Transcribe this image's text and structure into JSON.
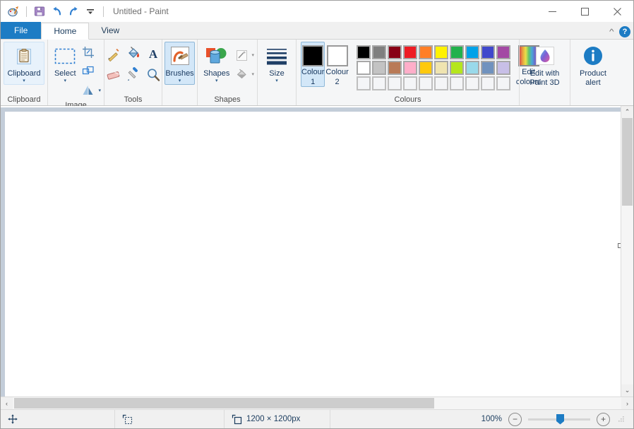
{
  "window": {
    "title": "Untitled - Paint",
    "quick_access": [
      {
        "name": "paint-app-icon",
        "label": "Paint"
      },
      {
        "name": "save-icon",
        "label": "Save"
      },
      {
        "name": "undo-icon",
        "label": "Undo"
      },
      {
        "name": "redo-icon",
        "label": "Redo"
      },
      {
        "name": "customize-qat-icon",
        "label": "Customise Quick Access Toolbar"
      }
    ],
    "controls": {
      "minimize": "—",
      "maximize": "□",
      "close": "✕"
    }
  },
  "tabs": [
    {
      "id": "file",
      "label": "File",
      "active": false
    },
    {
      "id": "home",
      "label": "Home",
      "active": true
    },
    {
      "id": "view",
      "label": "View",
      "active": false
    }
  ],
  "ribbon_right": {
    "collapse_label": "^",
    "help_label": "?"
  },
  "ribbon": {
    "groups": [
      {
        "id": "clipboard",
        "label": "Clipboard",
        "buttons": [
          {
            "name": "clipboard-button",
            "label": "Clipboard",
            "arrow": "▾",
            "state": "hot"
          }
        ]
      },
      {
        "id": "image",
        "label": "Image",
        "buttons": [
          {
            "name": "select-button",
            "label": "Select",
            "arrow": "▾"
          },
          {
            "name": "crop-button",
            "label": "Crop"
          },
          {
            "name": "resize-button",
            "label": "Resize"
          },
          {
            "name": "rotate-button",
            "label": "Rotate",
            "arrow": "▾"
          }
        ]
      },
      {
        "id": "tools",
        "label": "Tools",
        "buttons": [
          {
            "name": "pencil-tool",
            "label": "Pencil"
          },
          {
            "name": "fill-tool",
            "label": "Fill with colour"
          },
          {
            "name": "text-tool",
            "label": "Text"
          },
          {
            "name": "eraser-tool",
            "label": "Eraser"
          },
          {
            "name": "colour-picker-tool",
            "label": "Colour picker"
          },
          {
            "name": "magnifier-tool",
            "label": "Magnifier"
          }
        ]
      },
      {
        "id": "brushes",
        "label": "",
        "buttons": [
          {
            "name": "brushes-button",
            "label": "Brushes",
            "arrow": "▾",
            "state": "sel"
          }
        ]
      },
      {
        "id": "shapes",
        "label": "Shapes",
        "buttons": [
          {
            "name": "shapes-button",
            "label": "Shapes",
            "arrow": "▾"
          },
          {
            "name": "outline-button",
            "label": "Outline",
            "arrow": "▾"
          },
          {
            "name": "fill-button",
            "label": "Fill",
            "arrow": "▾"
          }
        ]
      },
      {
        "id": "size",
        "label": "",
        "buttons": [
          {
            "name": "size-button",
            "label": "Size",
            "arrow": "▾"
          }
        ]
      },
      {
        "id": "colours",
        "label": "Colours",
        "buttons": [
          {
            "name": "colour-1-button",
            "label1": "Colour",
            "label2": "1",
            "state": "sel",
            "value": "#000000"
          },
          {
            "name": "colour-2-button",
            "label1": "Colour",
            "label2": "2",
            "value": "#ffffff"
          },
          {
            "name": "edit-colours-button",
            "label1": "Edit",
            "label2": "colours"
          }
        ]
      },
      {
        "id": "paint3d",
        "label": "",
        "buttons": [
          {
            "name": "edit-with-paint-3d-button",
            "label1": "Edit with",
            "label2": "Paint 3D"
          }
        ]
      },
      {
        "id": "alert",
        "label": "",
        "buttons": [
          {
            "name": "product-alert-button",
            "label1": "Product",
            "label2": "alert"
          }
        ]
      }
    ],
    "palette": {
      "row1": [
        "#000000",
        "#7f7f7f",
        "#880015",
        "#ed1c24",
        "#ff7f27",
        "#fff200",
        "#22b14c",
        "#00a2e8",
        "#3f48cc",
        "#a349a4"
      ],
      "row2": [
        "#ffffff",
        "#c3c3c3",
        "#b97a57",
        "#ffaec9",
        "#ffc90e",
        "#efe4b0",
        "#b5e61d",
        "#99d9ea",
        "#7092be",
        "#c8bfe7"
      ],
      "row3": [
        "",
        "",
        "",
        "",
        "",
        "",
        "",
        "",
        "",
        ""
      ]
    }
  },
  "status": {
    "cursor_position": "",
    "selection_size": "",
    "image_size": "1200 × 1200px",
    "zoom_level": "100%",
    "zoom_out_label": "−",
    "zoom_in_label": "+"
  },
  "scrollbars": {
    "vertical_up": "⌃",
    "vertical_down": "⌄",
    "horizontal_left": "‹",
    "horizontal_right": "›"
  },
  "colors": {
    "accent": "#1d7cc4",
    "ribbon_bg": "#f5f6f7",
    "canvas_bg": "#c3cdd9",
    "text_blue": "#17375e"
  }
}
